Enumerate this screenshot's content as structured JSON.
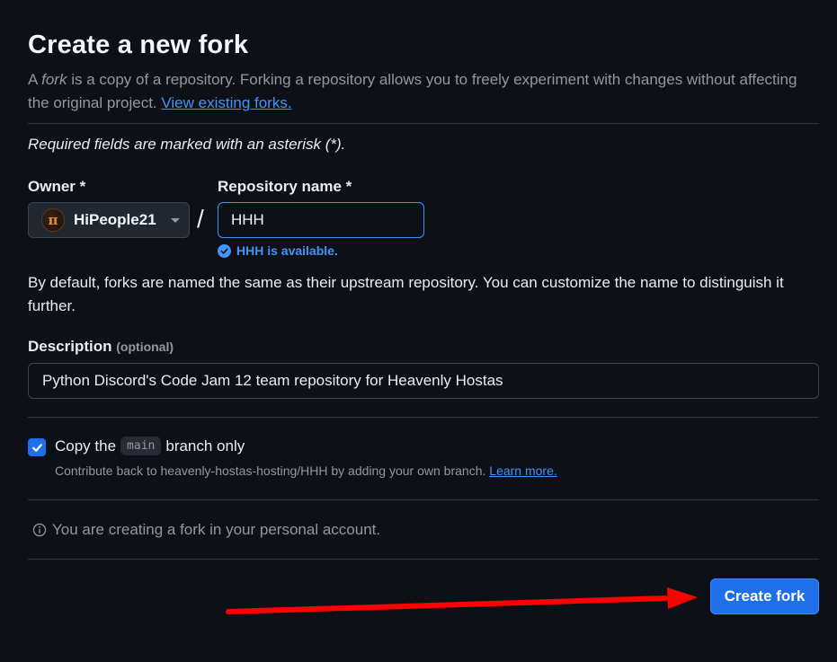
{
  "header": {
    "title": "Create a new fork",
    "intro_prefix": "A ",
    "intro_em": "fork",
    "intro_rest": " is a copy of a repository. Forking a repository allows you to freely experiment with changes without affecting the original project. ",
    "view_forks_link": "View existing forks."
  },
  "form": {
    "required_note": "Required fields are marked with an asterisk (*).",
    "owner": {
      "label": "Owner *",
      "avatar_glyph": "π",
      "selected": "HiPeople21"
    },
    "separator": "/",
    "repo_name": {
      "label": "Repository name *",
      "value": "HHH",
      "availability": "HHH is available."
    },
    "naming_help": "By default, forks are named the same as their upstream repository. You can customize the name to distinguish it further.",
    "description": {
      "label": "Description",
      "optional": "(optional)",
      "value": "Python Discord's Code Jam 12 team repository for Heavenly Hostas"
    },
    "copy_branch": {
      "checked": true,
      "prefix": "Copy the",
      "branch": "main",
      "suffix": "branch only",
      "help": "Contribute back to heavenly-hostas-hosting/HHH by adding your own branch.",
      "learn_more": "Learn more."
    },
    "personal_note": "You are creating a fork in your personal account.",
    "submit_label": "Create fork"
  },
  "colors": {
    "background": "#0d1117",
    "accent": "#1f6feb",
    "link": "#4493f8",
    "annotation_arrow": "#ff0000"
  },
  "icons": {
    "owner_dropdown": "chevron-down-icon",
    "availability": "check-circle-icon",
    "checkbox": "checkmark-icon",
    "note": "info-icon",
    "annotation": "red-arrow-icon"
  }
}
